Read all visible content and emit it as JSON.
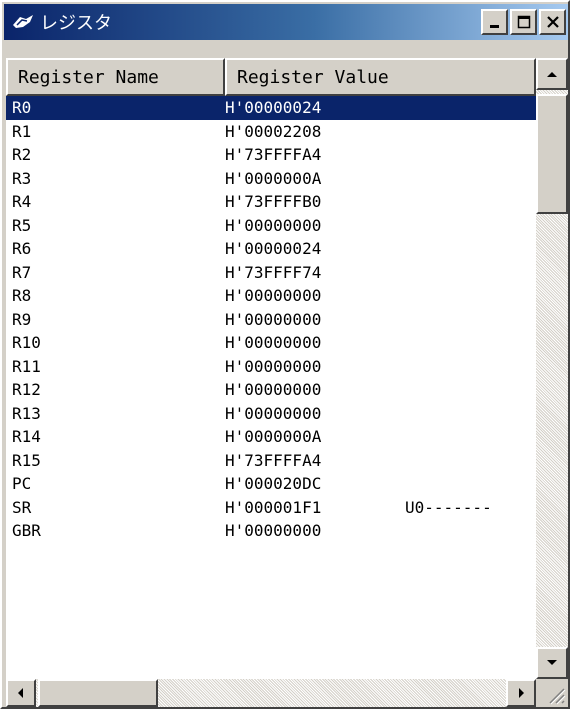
{
  "window": {
    "title": "レジスタ",
    "icon": "register-window-icon",
    "controls": [
      "minimize-icon",
      "maximize-icon",
      "close-icon"
    ]
  },
  "columns": {
    "name": "Register Name",
    "value": "Register Value"
  },
  "rows": [
    {
      "name": "R0",
      "value": "H'00000024",
      "extra": "",
      "selected": true
    },
    {
      "name": "R1",
      "value": "H'00002208",
      "extra": ""
    },
    {
      "name": "R2",
      "value": "H'73FFFFA4",
      "extra": ""
    },
    {
      "name": "R3",
      "value": "H'0000000A",
      "extra": ""
    },
    {
      "name": "R4",
      "value": "H'73FFFFB0",
      "extra": ""
    },
    {
      "name": "R5",
      "value": "H'00000000",
      "extra": ""
    },
    {
      "name": "R6",
      "value": "H'00000024",
      "extra": ""
    },
    {
      "name": "R7",
      "value": "H'73FFFF74",
      "extra": ""
    },
    {
      "name": "R8",
      "value": "H'00000000",
      "extra": ""
    },
    {
      "name": "R9",
      "value": "H'00000000",
      "extra": ""
    },
    {
      "name": "R10",
      "value": "H'00000000",
      "extra": ""
    },
    {
      "name": "R11",
      "value": "H'00000000",
      "extra": ""
    },
    {
      "name": "R12",
      "value": "H'00000000",
      "extra": ""
    },
    {
      "name": "R13",
      "value": "H'00000000",
      "extra": ""
    },
    {
      "name": "R14",
      "value": "H'0000000A",
      "extra": ""
    },
    {
      "name": "R15",
      "value": "H'73FFFFA4",
      "extra": ""
    },
    {
      "name": "PC",
      "value": "H'000020DC",
      "extra": ""
    },
    {
      "name": "SR",
      "value": "H'000001F1",
      "extra": "U0-------"
    },
    {
      "name": "GBR",
      "value": "H'00000000",
      "extra": ""
    }
  ],
  "colors": {
    "selection": "#0a246a",
    "titlebar_start": "#0a246a",
    "titlebar_end": "#a6caf0",
    "face": "#d4d0c8"
  }
}
